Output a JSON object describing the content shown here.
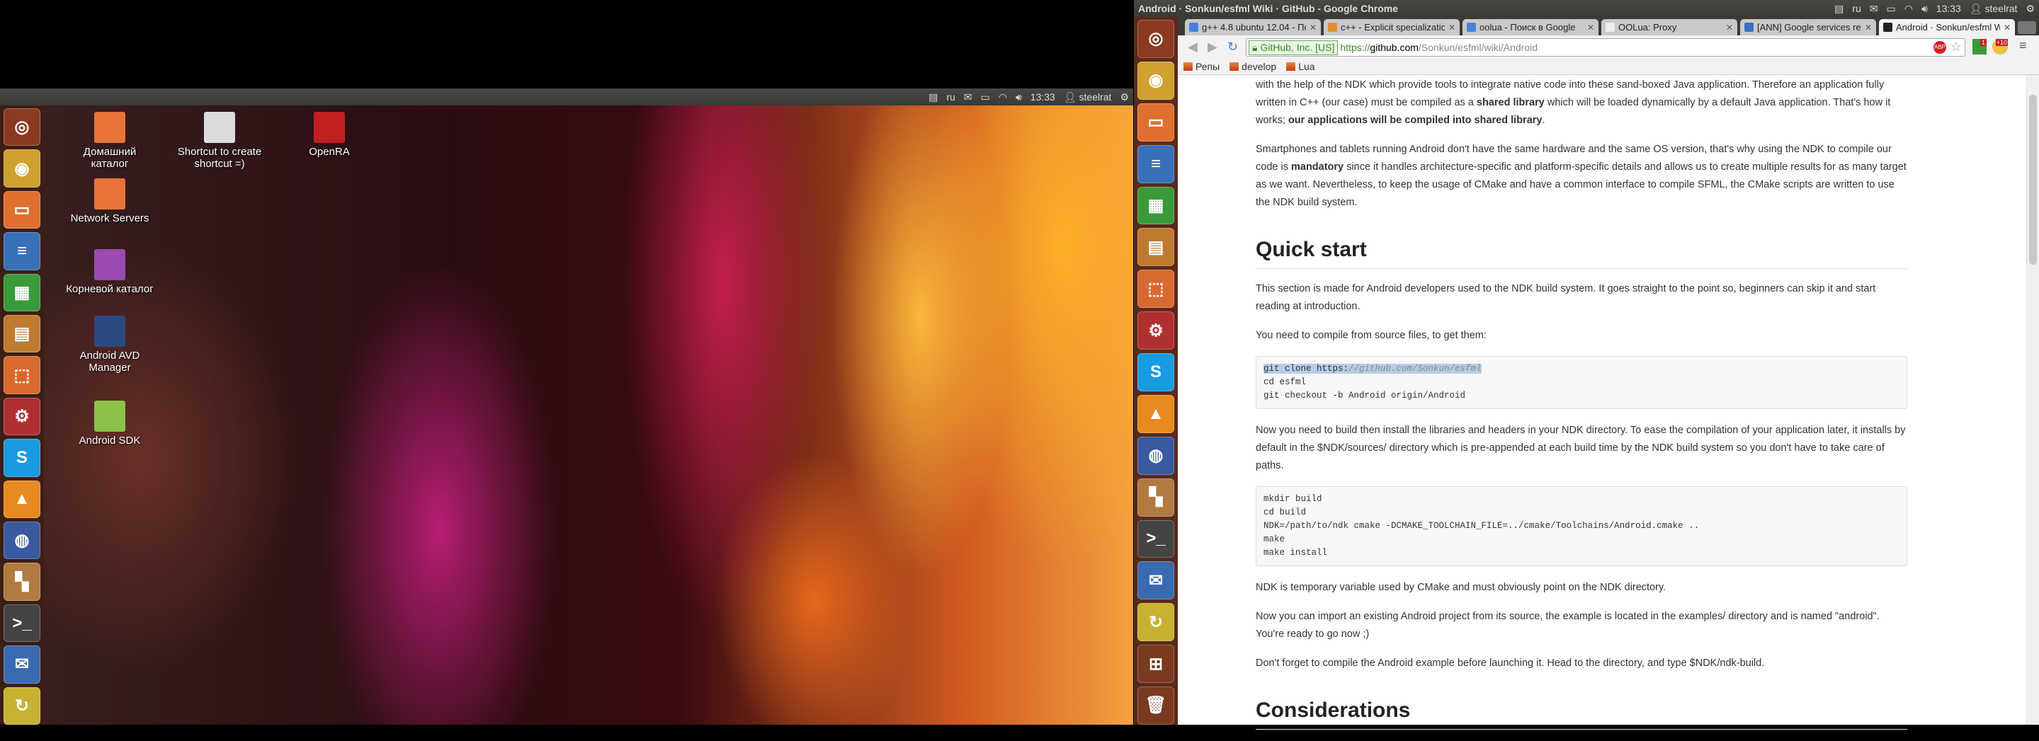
{
  "left_panel": {
    "keyboard": "▤",
    "lang": "ru",
    "time": "13:33",
    "user": "steelrat"
  },
  "right_panel": {
    "window_title": "Android · Sonkun/esfml Wiki · GitHub - Google Chrome",
    "lang": "ru",
    "time": "13:33",
    "user": "steelrat"
  },
  "desktop_icons": [
    {
      "label": "Домашний каталог",
      "color": "#e8743a"
    },
    {
      "label": "Shortcut to create shortcut =)",
      "color": "#dcdcdc"
    },
    {
      "label": "OpenRA",
      "color": "#c02020"
    },
    {
      "label": "Network Servers",
      "color": "#e8743a"
    },
    {
      "label": "Корневой каталог",
      "color": "#9a4ab0"
    },
    {
      "label": "Android AVD Manager",
      "color": "#2a4a80"
    },
    {
      "label": "Android SDK",
      "color": "#8ac24a"
    }
  ],
  "launcher_left": [
    {
      "name": "ubuntu-dash",
      "color": "#8a3a20",
      "g": "◎"
    },
    {
      "name": "chrome",
      "color": "#d0a030",
      "g": "◉"
    },
    {
      "name": "files",
      "color": "#e07030",
      "g": "▭"
    },
    {
      "name": "writer",
      "color": "#3a70b8",
      "g": "≡"
    },
    {
      "name": "calc",
      "color": "#3a9a3a",
      "g": "▦"
    },
    {
      "name": "impress",
      "color": "#c07a30",
      "g": "▤"
    },
    {
      "name": "software-center",
      "color": "#d86a30",
      "g": "⬚"
    },
    {
      "name": "system-settings",
      "color": "#b03030",
      "g": "⚙"
    },
    {
      "name": "skype",
      "color": "#1a9ae0",
      "g": "S"
    },
    {
      "name": "vlc",
      "color": "#e88a20",
      "g": "▲"
    },
    {
      "name": "sphere-app",
      "color": "#3a5aa0",
      "g": "◍"
    },
    {
      "name": "blocks-app",
      "color": "#b07a40",
      "g": "▚"
    },
    {
      "name": "terminal",
      "color": "#444",
      "g": ">_"
    },
    {
      "name": "thunderbird",
      "color": "#3a6ab0",
      "g": "✉"
    },
    {
      "name": "extra-app",
      "color": "#c8b030",
      "g": "↻"
    }
  ],
  "launcher_right": [
    {
      "name": "ubuntu-dash",
      "color": "#8a3a20",
      "g": "◎"
    },
    {
      "name": "chrome",
      "color": "#d0a030",
      "g": "◉"
    },
    {
      "name": "files",
      "color": "#e07030",
      "g": "▭"
    },
    {
      "name": "writer",
      "color": "#3a70b8",
      "g": "≡"
    },
    {
      "name": "calc",
      "color": "#3a9a3a",
      "g": "▦"
    },
    {
      "name": "impress",
      "color": "#c07a30",
      "g": "▤"
    },
    {
      "name": "software-center",
      "color": "#d86a30",
      "g": "⬚"
    },
    {
      "name": "system-settings",
      "color": "#b03030",
      "g": "⚙"
    },
    {
      "name": "skype",
      "color": "#1a9ae0",
      "g": "S"
    },
    {
      "name": "vlc",
      "color": "#e88a20",
      "g": "▲"
    },
    {
      "name": "sphere-app",
      "color": "#3a5aa0",
      "g": "◍"
    },
    {
      "name": "blocks-app",
      "color": "#b07a40",
      "g": "▚"
    },
    {
      "name": "terminal",
      "color": "#444",
      "g": ">_"
    },
    {
      "name": "thunderbird",
      "color": "#3a6ab0",
      "g": "✉"
    },
    {
      "name": "update-app",
      "color": "#c8b030",
      "g": "↻"
    },
    {
      "name": "workspace-switcher",
      "color": "#7a3a20",
      "g": "⊞"
    },
    {
      "name": "trash",
      "color": "#7a3a20",
      "g": "🗑"
    }
  ],
  "tabs": [
    {
      "title": "g++ 4.8 ubuntu 12.04 - По",
      "color": "#4a80e0"
    },
    {
      "title": "c++ - Explicit specializatio",
      "color": "#e09030"
    },
    {
      "title": "oolua - Поиск в Google",
      "color": "#4a80e0"
    },
    {
      "title": "OOLua: Proxy",
      "color": "#eee"
    },
    {
      "title": "[ANN] Google services rel",
      "color": "#3a70c0"
    },
    {
      "title": "Android · Sonkun/esfml W",
      "color": "#222"
    }
  ],
  "omnibox": {
    "ev": "GitHub, Inc. [US]",
    "scheme": "https://",
    "host": "github.com",
    "path": "/Sonkun/esfml/wiki/Android"
  },
  "extensions": {
    "abp": "ABP",
    "badge1": "1",
    "badge2": "+10"
  },
  "bookmarks": [
    "Репы",
    "develop",
    "Lua"
  ],
  "content": {
    "p1a": "with the help of the NDK which provide tools to integrate native code into these sand-boxed Java application. Therefore an application fully written in C++ (our case) must be compiled as a ",
    "p1b": "shared library",
    "p1c": " which will be loaded dynamically by a default Java application. That's how it works; ",
    "p1d": "our applications will be compiled into shared library",
    "p1e": ".",
    "p2a": "Smartphones and tablets running Android don't have the same hardware and the same OS version, that's why using the NDK to compile our code is ",
    "p2b": "mandatory",
    "p2c": " since it handles architecture-specific and platform-specific details and allows us to create multiple results for as many target as we want. Nevertheless, to keep the usage of CMake and have a common interface to compile SFML, the CMake scripts are written to use the NDK build system.",
    "h_quick": "Quick start",
    "p3": "This section is made for Android developers used to the NDK build system. It goes straight to the point so, beginners can skip it and start reading at introduction.",
    "p4": "You need to compile from source files, to get them:",
    "code1_sel": "git clone https:",
    "code1_url": "//github.com/Sonkun/esfml",
    "code1_rest": "\ncd esfml\ngit checkout -b Android origin/Android",
    "p5": "Now you need to build then install the libraries and headers in your NDK directory. To ease the compilation of your application later, it installs by default in the $NDK/sources/ directory which is pre-appended at each build time by the NDK build system so you don't have to take care of paths.",
    "code2": "mkdir build\ncd build\nNDK=/path/to/ndk cmake -DCMAKE_TOOLCHAIN_FILE=../cmake/Toolchains/Android.cmake ..\nmake\nmake install",
    "p6": "NDK is temporary variable used by CMake and must obviously point on the NDK directory.",
    "p7": "Now you can import an existing Android project from its source, the example is located in the examples/ directory and is named \"android\". You're ready to go now ;)",
    "p8": "Don't forget to compile the Android example before launching it. Head to the directory, and type $NDK/ndk-build.",
    "h_cons": "Considerations"
  }
}
